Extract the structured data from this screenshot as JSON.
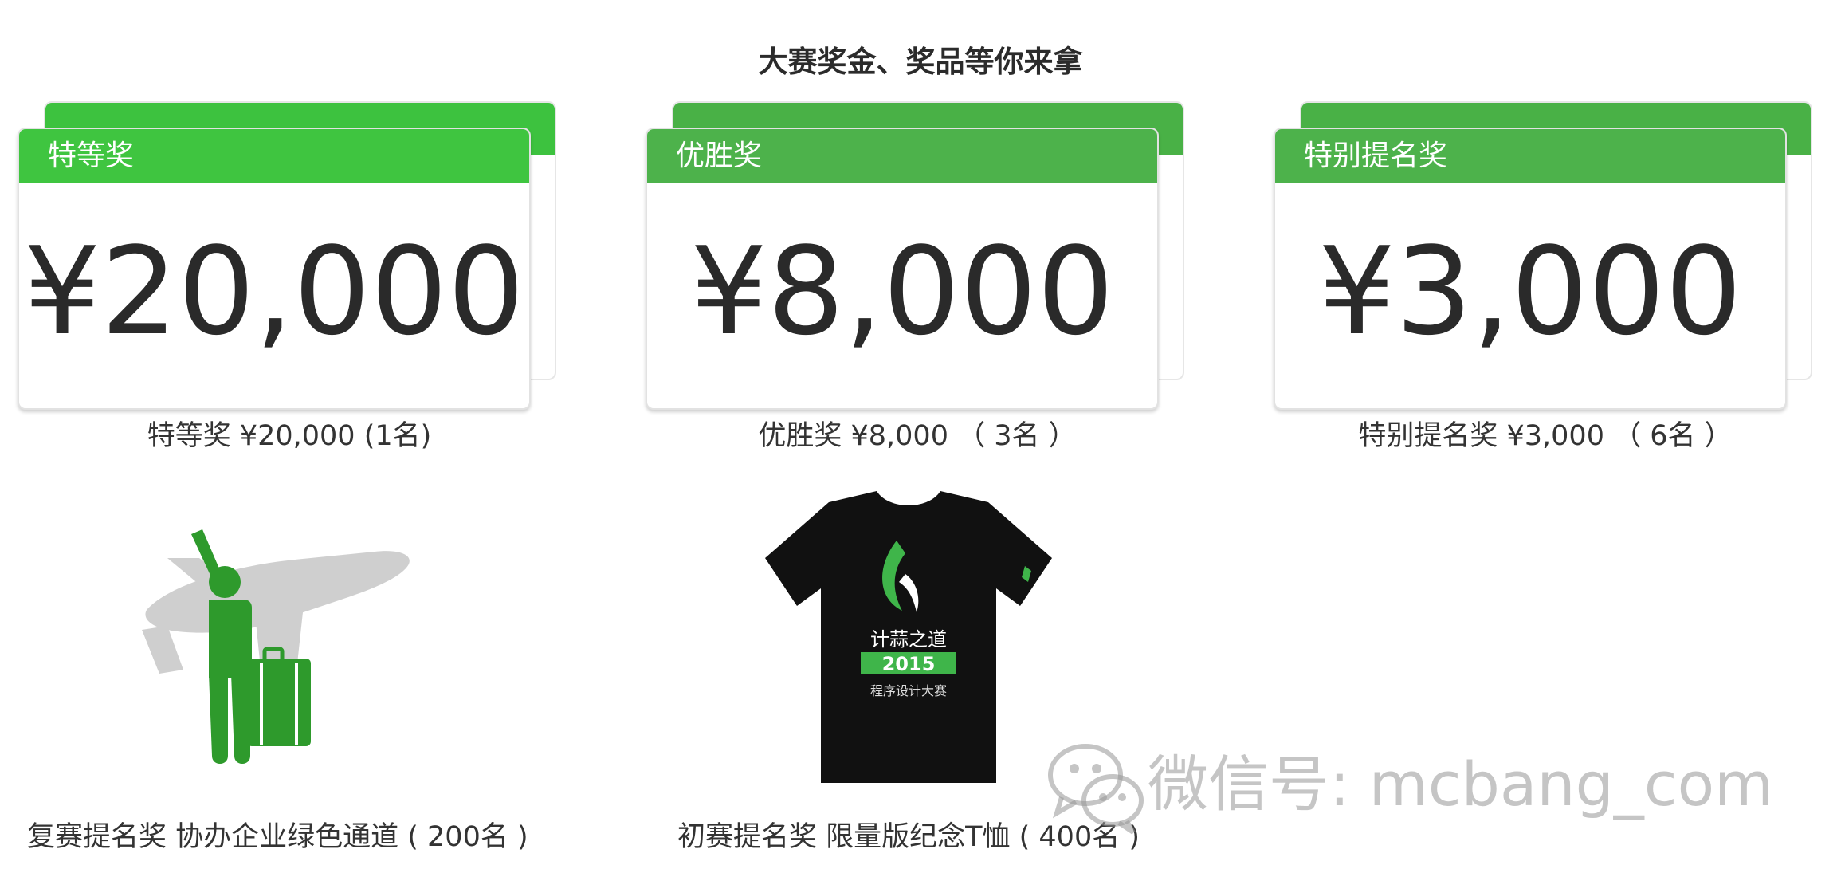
{
  "page": {
    "title": "大赛奖金、奖品等你来拿"
  },
  "prizes": [
    {
      "label": "特等奖",
      "amount": "¥20,000",
      "caption": "特等奖 ¥20,000 (1名)"
    },
    {
      "label": "优胜奖",
      "amount": "¥8,000",
      "caption": "优胜奖 ¥8,000 （ 3名 ）"
    },
    {
      "label": "特别提名奖",
      "amount": "¥3,000",
      "caption": "特别提名奖 ¥3,000 （ 6名 ）"
    }
  ],
  "rewards": [
    {
      "icon": "traveler-airplane-icon",
      "caption": "复赛提名奖 协办企业绿色通道 ( 200名 )"
    },
    {
      "icon": "tshirt-icon",
      "shirt_text": {
        "brand": "计蒜之道",
        "year": "2015",
        "subtitle": "程序设计大赛"
      },
      "caption": "初赛提名奖 限量版纪念T恤 ( 400名 )"
    }
  ],
  "watermark": {
    "icon": "wechat-icon",
    "text": "微信号: mcbang_com"
  },
  "colors": {
    "accent_green": "#4db24b",
    "accent_green_bright": "#3fc540",
    "text_dark": "#2a2a2a"
  }
}
